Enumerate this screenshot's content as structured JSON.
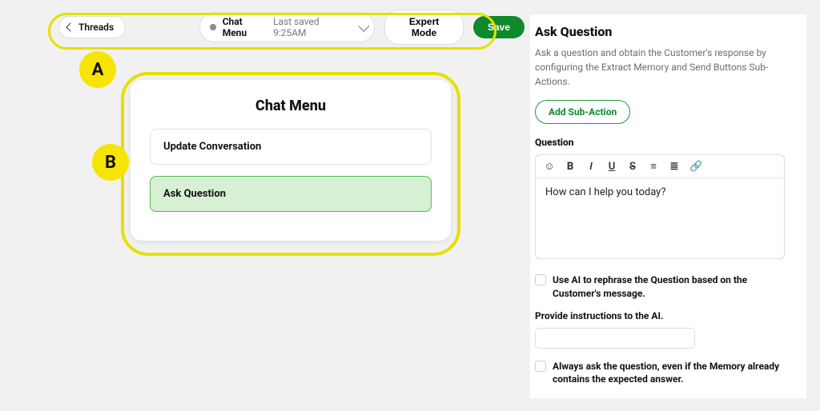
{
  "topbar": {
    "back_label": "Threads",
    "doc_title": "Chat Menu",
    "last_saved": "Last saved 9:25AM",
    "expert_label": "Expert Mode",
    "save_label": "Save"
  },
  "annotations": {
    "a": "A",
    "b": "B"
  },
  "card": {
    "title": "Chat Menu",
    "actions": [
      {
        "label": "Update Conversation",
        "selected": false
      },
      {
        "label": "Ask Question",
        "selected": true
      }
    ]
  },
  "right": {
    "title": "Ask Question",
    "description": "Ask a question and obtain the Customer's response by configuring the Extract Memory and Send Buttons Sub-Actions.",
    "add_sub_action": "Add Sub-Action",
    "question_label": "Question",
    "editor_value": "How can I help you today?",
    "toolbar_icons": {
      "emoji": "☺",
      "bold": "B",
      "italic": "I",
      "underline": "U",
      "strike": "S",
      "olist": "≡",
      "ulist": "≣",
      "link": "🔗"
    },
    "rephrase_label": "Use AI to rephrase the Question based on the Customer's message.",
    "instructions_label": "Provide instructions to the AI.",
    "always_ask_label": "Always ask the question, even if the Memory already contains the expected answer."
  }
}
